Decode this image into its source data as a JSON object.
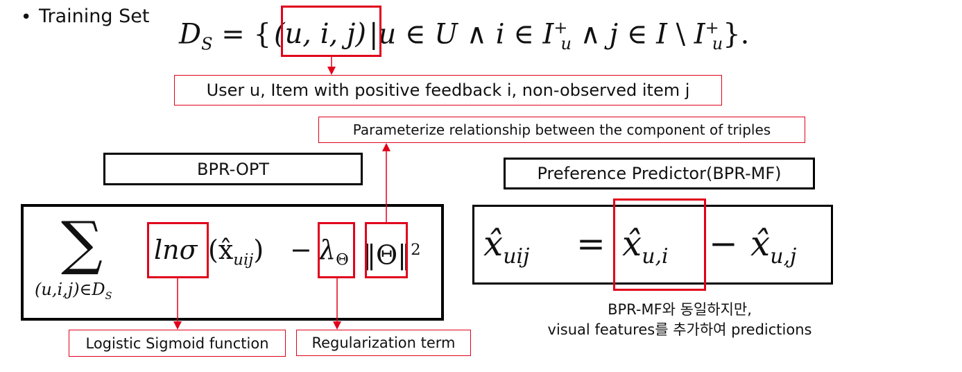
{
  "training_set": {
    "bullet": "•",
    "label": "Training Set",
    "formula_lhs": "D",
    "formula_lhs_sub": "S",
    "formula_triple": "(u, i, j)",
    "formula_cond_1": "u ∈ ",
    "formula_cond_U": "U",
    "formula_cond_2": " ∧ i ∈ ",
    "formula_cond_I1": "I",
    "formula_cond_I1_sup": "+",
    "formula_cond_I1_sub": "u",
    "formula_cond_3": " ∧ j ∈ ",
    "formula_cond_I2": "I",
    "formula_cond_4": " \\ ",
    "formula_cond_I3": "I",
    "formula_cond_I3_sup": "+",
    "formula_cond_I3_sub": "u",
    "formula_end": "}."
  },
  "triple_caption": "User u, Item with positive feedback i, non-observed item j",
  "parameterize_caption": "Parameterize relationship between the component of triples",
  "bpr_opt": {
    "title": "BPR-OPT",
    "sum_symbol": "∑",
    "sum_index": "(u,i,j)∈D",
    "sum_index_sub": "S",
    "ln_sigma": "lnσ",
    "x_hat_arg": "(x̂",
    "x_hat_sub": "uij",
    "x_hat_close": ")",
    "minus": "−",
    "lambda": "λ",
    "lambda_sub": "Θ",
    "norm": "‖Θ‖",
    "norm_sup": "2",
    "sigmoid_caption": "Logistic Sigmoid function",
    "regularization_caption": "Regularization term"
  },
  "predictor": {
    "title": "Preference Predictor(BPR-MF)",
    "lhs": "x̂",
    "lhs_sub": "uij",
    "equals": "=",
    "term1": "x̂",
    "term1_sub": "u,i",
    "minus": "−",
    "term2": "x̂",
    "term2_sub": "u,j",
    "note_line1": "BPR-MF와 동일하지만,",
    "note_line2": "visual features를 추가하여 predictions"
  },
  "colors": {
    "accent_red": "#e0001b",
    "border_black": "#000000"
  }
}
